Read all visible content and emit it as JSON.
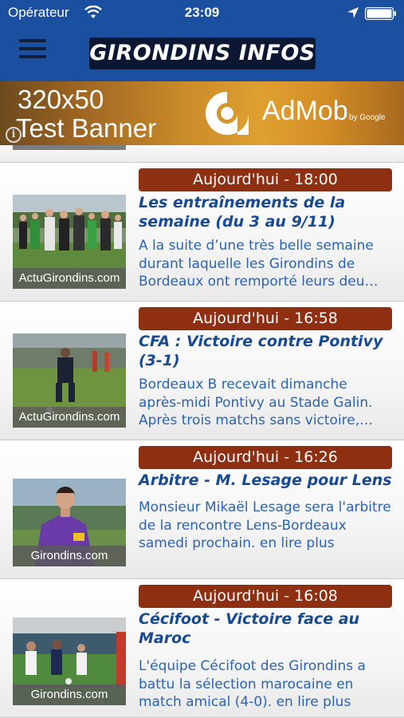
{
  "status_bar": {
    "carrier": "Opérateur",
    "time": "23:09"
  },
  "nav": {
    "logo": "GIRONDINS INFOS"
  },
  "ad": {
    "line1": "320x50",
    "line2": "Test Banner",
    "brand": "AdMob",
    "by": "by Google",
    "info": "i"
  },
  "articles": [
    {
      "date": "Aujourd'hui - 18:00",
      "title": "Les entraînements de la semaine (du 3 au 9/11)",
      "summary": "A la suite d’une très belle semaine durant laquelle les Girondins de Bordeaux ont remporté leurs deu…",
      "source": "ActuGirondins.com"
    },
    {
      "date": "Aujourd'hui - 16:58",
      "title": "CFA : Victoire contre Pontivy (3-1)",
      "summary": "Bordeaux B recevait dimanche après-midi Pontivy au Stade Galin. Après trois matchs sans victoire,…",
      "source": "ActuGirondins.com"
    },
    {
      "date": "Aujourd'hui - 16:26",
      "title": "Arbitre - M. Lesage pour Lens",
      "summary": "Monsieur Mikaël Lesage sera l'arbitre de la rencontre Lens-Bordeaux samedi prochain.  en lire plus",
      "source": "Girondins.com"
    },
    {
      "date": "Aujourd'hui - 16:08",
      "title": "Cécifoot - Victoire face au Maroc",
      "summary": "L'équipe Cécifoot des Girondins a battu la sélection marocaine en match amical (4-0).  en lire plus",
      "source": "Girondins.com"
    }
  ],
  "colors": {
    "nav_blue": "#1b4fa0",
    "badge": "#8e2f12",
    "title": "#174a94",
    "summary": "#2a63b8"
  },
  "icons": [
    "wifi-icon",
    "location-arrow-icon",
    "battery-icon",
    "hamburger-menu-icon",
    "ad-info-icon"
  ]
}
